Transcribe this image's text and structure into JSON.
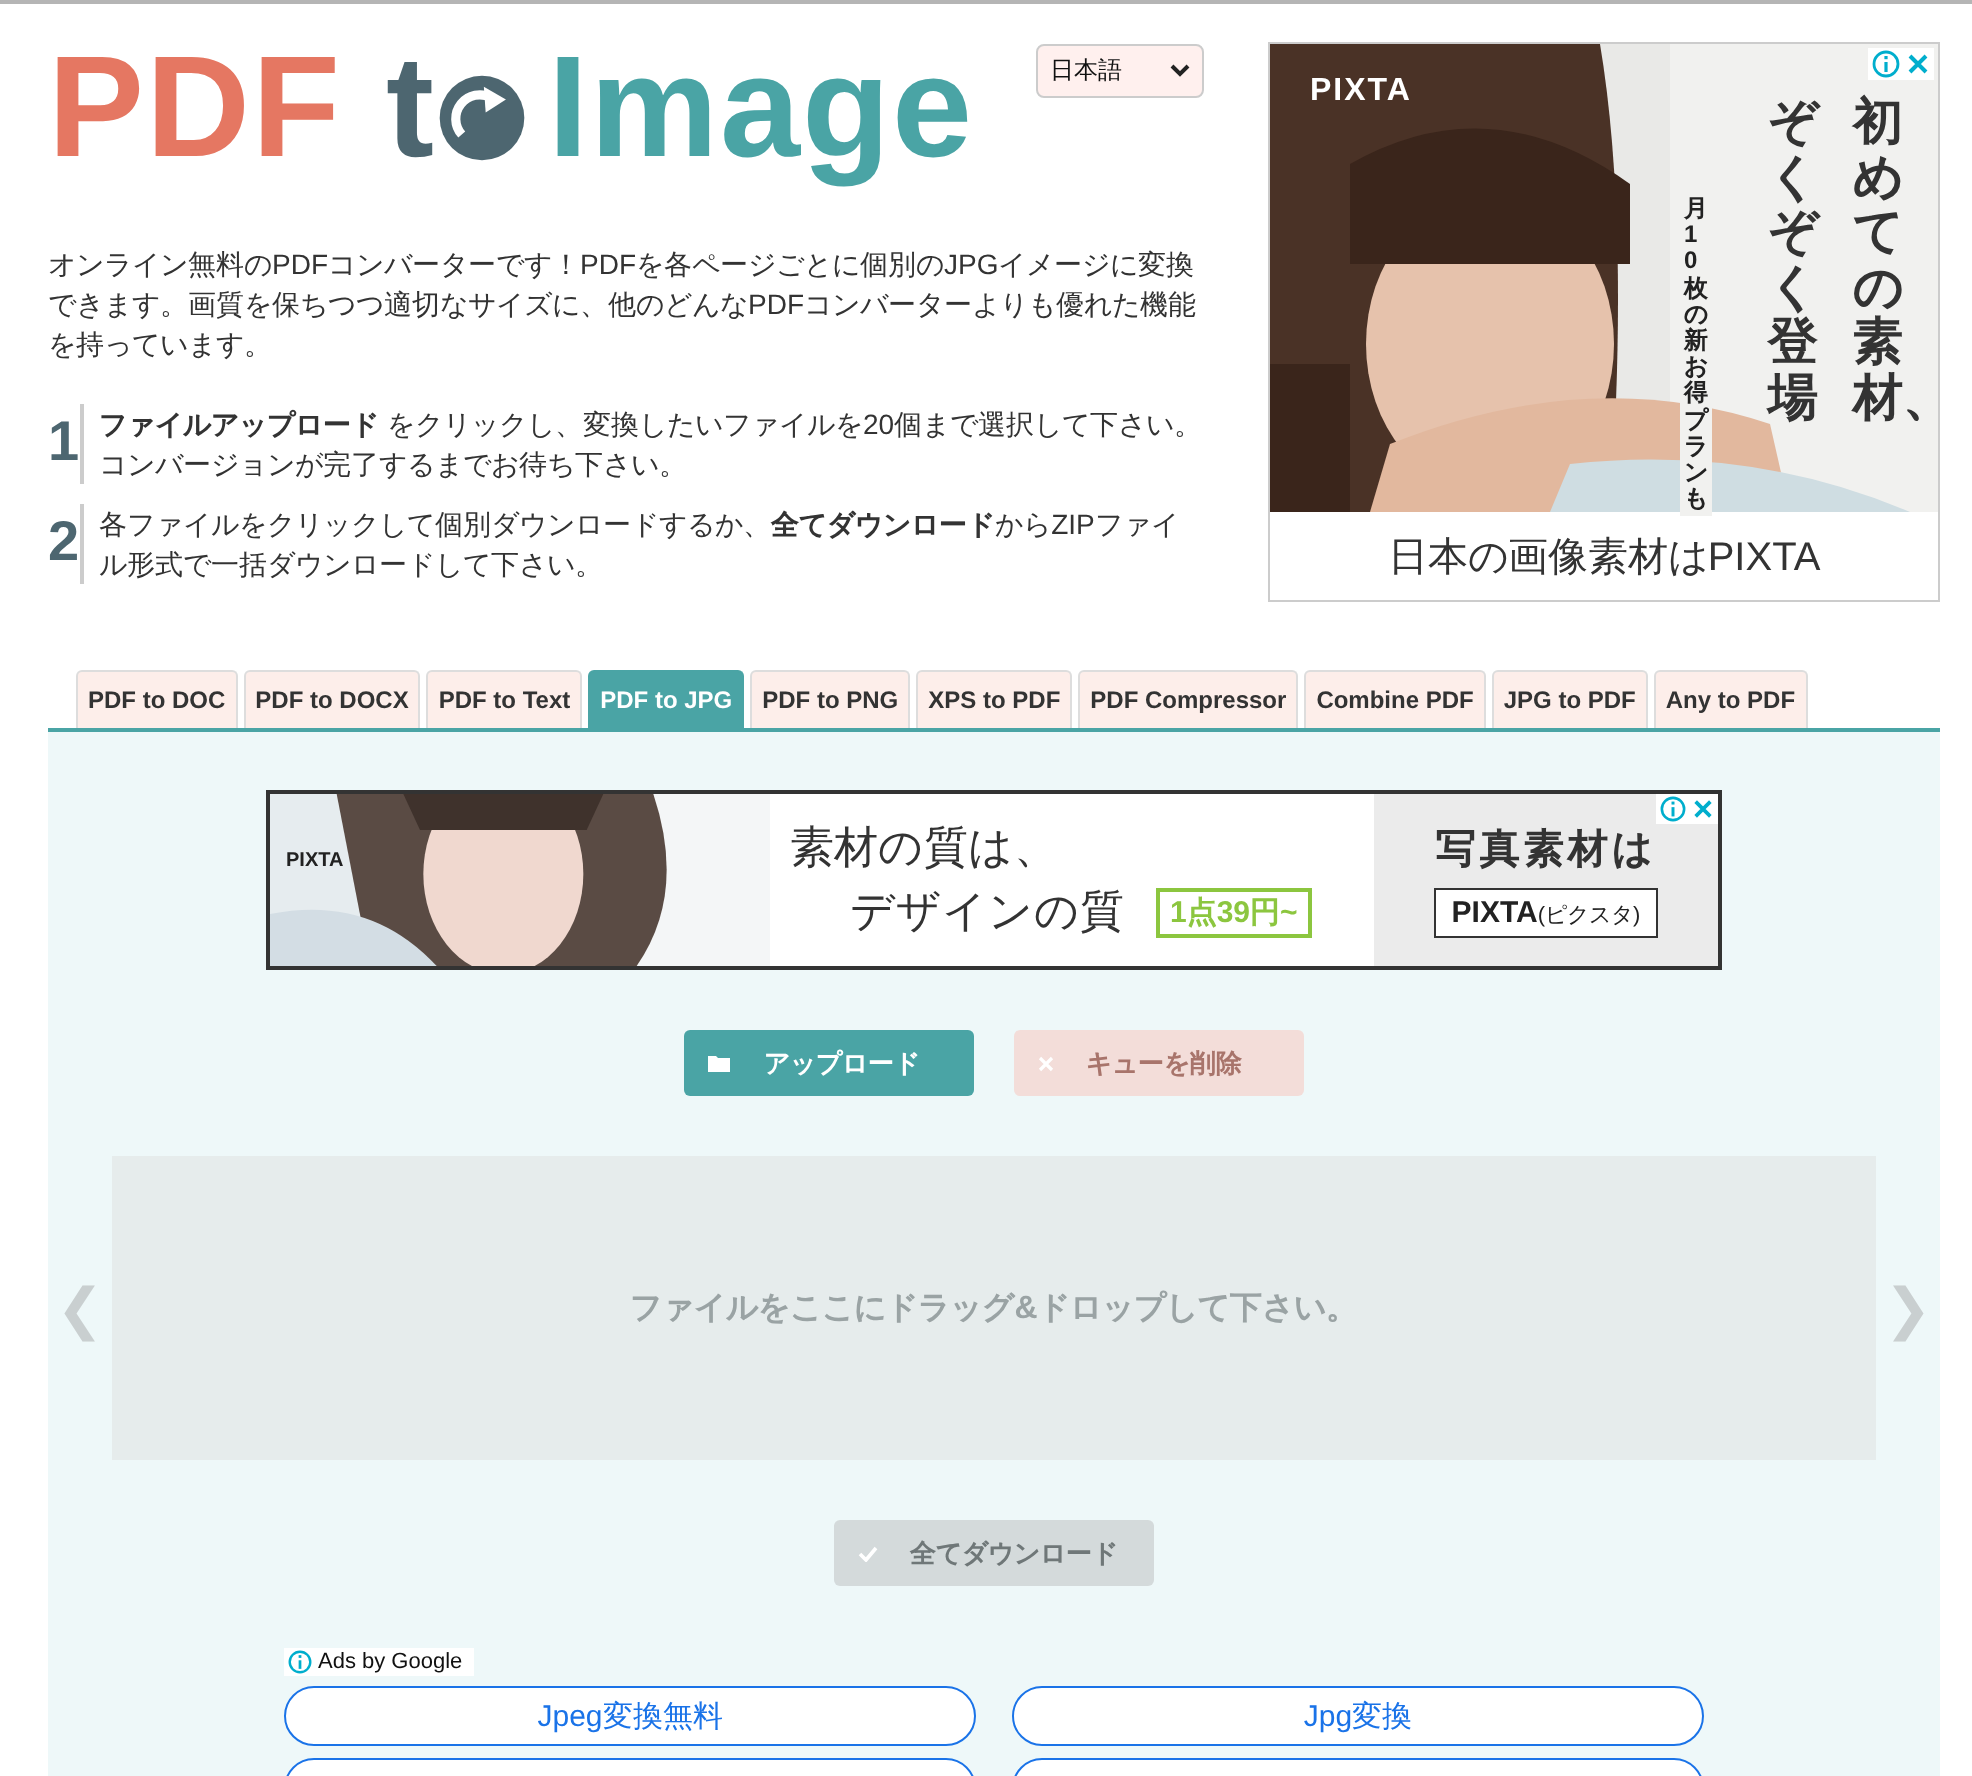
{
  "logo": {
    "part_1": "PDF",
    "part_2": "t",
    "part_3": "Image"
  },
  "language_select": {
    "value": "日本語"
  },
  "intro": "オンライン無料のPDFコンバーターです！PDFを各ページごとに個別のJPGイメージに変換できます。画質を保ちつつ適切なサイズに、他のどんなPDFコンバーターよりも優れた機能を持っています。",
  "steps": [
    {
      "number": "1",
      "text": "**ファイルアップロード** をクリックし、変換したいファイルを20個まで選択して下さい。コンバージョンが完了するまでお待ち下さい。"
    },
    {
      "number": "2",
      "text": "各ファイルをクリックして個別ダウンロードするか、**全てダウンロード**からZIPファイル形式で一括ダウンロードして下さい。"
    }
  ],
  "side_ad": {
    "brand": "PIXTA",
    "headline_1": "初めての素材、",
    "headline_2": "ぞくぞく登場",
    "subline": "月10枚の新お得プランも",
    "footer": "日本の画像素材はPIXTA"
  },
  "tabs": [
    {
      "label": "PDF to DOC",
      "selected": false
    },
    {
      "label": "PDF to DOCX",
      "selected": false
    },
    {
      "label": "PDF to Text",
      "selected": false
    },
    {
      "label": "PDF to JPG",
      "selected": true
    },
    {
      "label": "PDF to PNG",
      "selected": false
    },
    {
      "label": "XPS to PDF",
      "selected": false
    },
    {
      "label": "PDF Compressor",
      "selected": false
    },
    {
      "label": "Combine PDF",
      "selected": false
    },
    {
      "label": "JPG to PDF",
      "selected": false
    },
    {
      "label": "Any to PDF",
      "selected": false
    }
  ],
  "banner_ad": {
    "brand": "PIXTA",
    "line_1": "素材の質は、",
    "line_2": "デザインの質",
    "price": "1点39円~",
    "right_title": "写真素材は",
    "right_brand": "PIXTA",
    "right_brand_note": "(ピクスタ)"
  },
  "upload_button": {
    "label": "アップロード",
    "disabled": false
  },
  "clear_button": {
    "label": "キューを削除",
    "disabled": true
  },
  "drop_zone": {
    "text": "ファイルをここにドラッグ&ドロップして下さい。",
    "prev": "❮",
    "next": "❯"
  },
  "download_all_button": {
    "label": "全てダウンロード",
    "disabled": true
  },
  "ads_by": "Ads by Google",
  "ad_links": [
    {
      "kind": "link",
      "label": "Jpeg変換無料"
    },
    {
      "kind": "link",
      "label": "Jpg変換"
    },
    {
      "kind": "cut"
    },
    {
      "kind": "cut"
    }
  ]
}
